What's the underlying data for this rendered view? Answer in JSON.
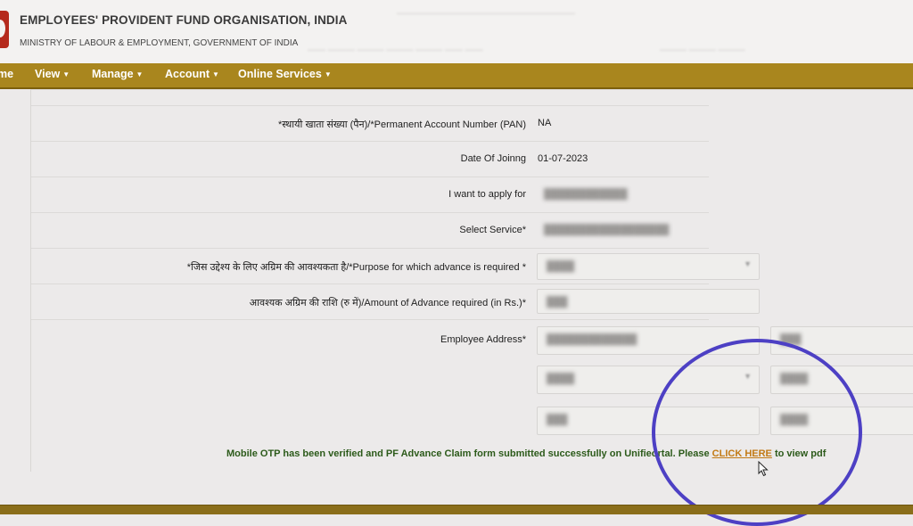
{
  "header": {
    "org_name": "EMPLOYEES' PROVIDENT FUND ORGANISATION, INDIA",
    "ministry": "MINISTRY OF LABOUR & EMPLOYMENT, GOVERNMENT OF INDIA"
  },
  "nav": {
    "home": "me",
    "items": [
      "View",
      "Manage",
      "Account",
      "Online Services"
    ]
  },
  "form": {
    "pan_label": "*स्थायी खाता संख्या (पैन)/*Permanent Account Number (PAN)",
    "pan_value": "NA",
    "doj_label": "Date Of Joinng",
    "doj_value": "01-07-2023",
    "apply_label": "I want to apply for",
    "service_label": "Select Service*",
    "purpose_label": "*जिस उद्देश्य के लिए अग्रिम की आवश्यकता है/*Purpose for which advance is required *",
    "amount_label": "आवश्यक अग्रिम की राशि (रु में)/Amount of Advance required (in Rs.)*",
    "address_label": "Employee Address*"
  },
  "message": {
    "text_before": "Mobile OTP has been verified and PF Advance Claim form submitted successfully on Unifie",
    "text_middle": "ortal. Please ",
    "link": "CLICK HERE",
    "text_after": " to view pdf"
  },
  "colors": {
    "nav_bg": "#a9861e",
    "link": "#c27a15",
    "success_text": "#2c5a1a",
    "highlight_circle": "#4d40c4"
  }
}
